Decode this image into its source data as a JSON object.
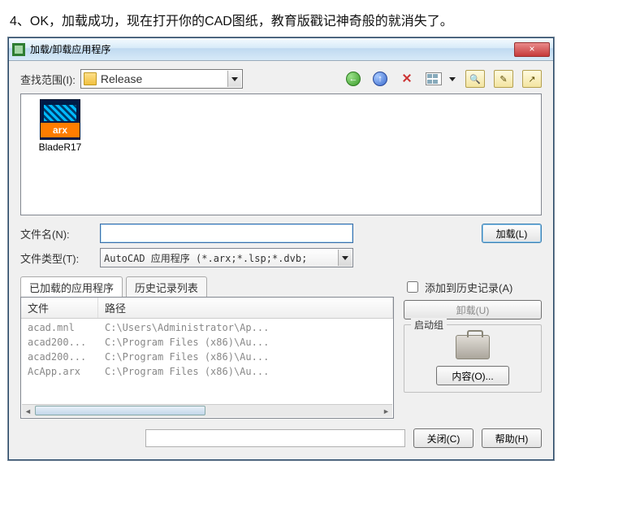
{
  "caption": "4、OK，加载成功，现在打开你的CAD图纸，教育版戳记神奇般的就消失了。",
  "window": {
    "title": "加载/卸载应用程序",
    "close": "×"
  },
  "lookin": {
    "label": "查找范围(I):",
    "value": "Release"
  },
  "tool_icons": {
    "back": "back-icon",
    "up": "up-icon",
    "delete": "delete-icon",
    "views": "views-icon",
    "search": "🔍",
    "t2": "✎",
    "t3": "↗"
  },
  "file_item": {
    "name": "BladeR17",
    "ext": "arx"
  },
  "filename": {
    "label": "文件名(N):",
    "value": "",
    "load_btn": "加载(L)"
  },
  "filetype": {
    "label": "文件类型(T):",
    "value": "AutoCAD 应用程序 (*.arx;*.lsp;*.dvb;"
  },
  "tabs": {
    "loaded": "已加载的应用程序",
    "history": "历史记录列表"
  },
  "list": {
    "col_file": "文件",
    "col_path": "路径",
    "rows": [
      {
        "file": "acad.mnl",
        "path": "C:\\Users\\Administrator\\Ap..."
      },
      {
        "file": "acad200...",
        "path": "C:\\Program Files (x86)\\Au..."
      },
      {
        "file": "acad200...",
        "path": "C:\\Program Files (x86)\\Au..."
      },
      {
        "file": "AcApp.arx",
        "path": "C:\\Program Files (x86)\\Au..."
      }
    ]
  },
  "right": {
    "add_history": "添加到历史记录(A)",
    "unload": "卸载(U)",
    "group_title": "启动组",
    "contents": "内容(O)..."
  },
  "footer": {
    "close": "关闭(C)",
    "help": "帮助(H)"
  }
}
